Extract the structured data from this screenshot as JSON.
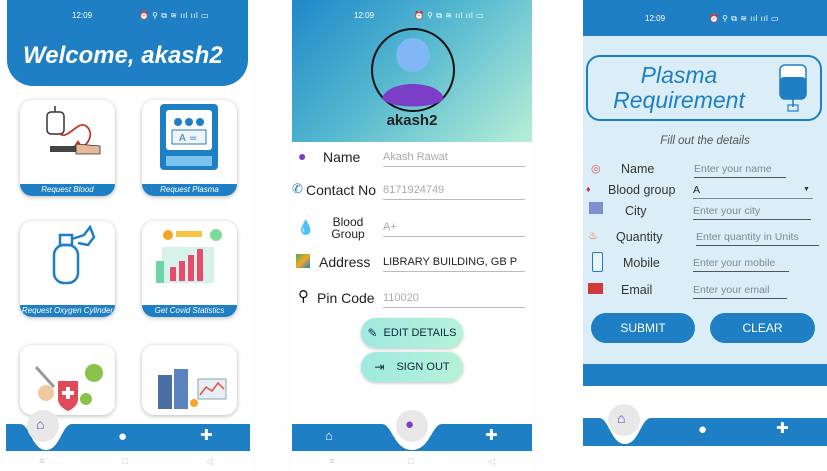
{
  "phone1": {
    "status": {
      "time": "12:09",
      "icons": "⏰ ⚲ ⧉ ≋ ııl ııl ▭"
    },
    "welcome": "Welcome, akash2",
    "tiles": [
      {
        "label": "Request Blood",
        "icon": "blood-bag-icon"
      },
      {
        "label": "Request Plasma",
        "icon": "plasma-machine-icon"
      },
      {
        "label": "Request Oxygen Cylinder",
        "icon": "oxygen-cylinder-icon"
      },
      {
        "label": "Get Covid Statistics",
        "icon": "statistics-chart-icon"
      },
      {
        "label": "",
        "icon": "virus-shield-icon"
      },
      {
        "label": "",
        "icon": "data-server-icon"
      }
    ],
    "nav": {
      "home": "home-icon",
      "profile": "person-icon",
      "add": "plus-icon"
    },
    "sysnav": [
      "≡",
      "□",
      "◁"
    ]
  },
  "phone2": {
    "status": {
      "time": "12:09",
      "icons": "⏰ ⚲ ⧉ ≋ ııl ııl ▭"
    },
    "username": "akash2",
    "fields": [
      {
        "label": "Name",
        "value": "Akash Rawat",
        "icon": "person-icon"
      },
      {
        "label": "Contact No",
        "value": "8171924749",
        "icon": "phone-icon"
      },
      {
        "label": "Blood Group",
        "value": "A+",
        "icon": "blood-drop-icon"
      },
      {
        "label": "Address",
        "value": "LIBRARY BUILDING, GB P",
        "icon": "map-icon"
      },
      {
        "label": "Pin Code",
        "value": "110020",
        "icon": "location-pin-icon"
      }
    ],
    "edit_label": "EDIT DETAILS",
    "signout_label": "SIGN OUT",
    "sysnav": [
      "≡",
      "□",
      "◁"
    ]
  },
  "phone3": {
    "status": {
      "time": "12:09",
      "icons": "⏰ ⚲ ⧉ ≋ ııl ııl ▭"
    },
    "title_line1": "Plasma",
    "title_line2": "Requirement",
    "subtitle": "Fill out the details",
    "fields": [
      {
        "label": "Name",
        "placeholder": "Enter your name",
        "icon": "person-circle-icon"
      },
      {
        "label": "Blood group",
        "value": "A",
        "icon": "blood-drop-icon"
      },
      {
        "label": "City",
        "placeholder": "Enter your city",
        "icon": "city-icon"
      },
      {
        "label": "Quantity",
        "placeholder": "Enter quantity in Units",
        "icon": "flame-icon"
      },
      {
        "label": "Mobile",
        "placeholder": "Enter your mobile",
        "icon": "mobile-icon"
      },
      {
        "label": "Email",
        "placeholder": "Enter your email",
        "icon": "mail-icon"
      }
    ],
    "submit_label": "SUBMIT",
    "clear_label": "CLEAR",
    "colors": {
      "brand": "#1e7fc4",
      "background": "#dbeef7"
    }
  }
}
